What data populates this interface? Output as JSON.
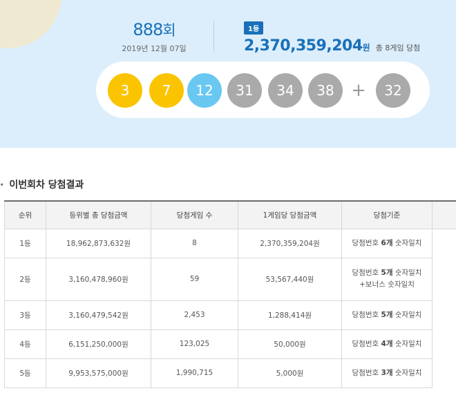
{
  "round": {
    "number": "888",
    "unit": "회",
    "date": "2019년 12월 07일"
  },
  "first_prize": {
    "badge": "1등",
    "amount": "2,370,359,204",
    "unit": "원",
    "games": "총 8게임 당첨"
  },
  "balls": [
    {
      "number": "3",
      "color": "#fbc400"
    },
    {
      "number": "7",
      "color": "#fbc400"
    },
    {
      "number": "12",
      "color": "#69c8f2"
    },
    {
      "number": "31",
      "color": "#aaaaaa"
    },
    {
      "number": "34",
      "color": "#aaaaaa"
    },
    {
      "number": "38",
      "color": "#aaaaaa"
    }
  ],
  "plus": "+",
  "bonus": {
    "number": "32",
    "color": "#aaaaaa"
  },
  "section": {
    "bullet": "·",
    "title": "이번회차 당첨결과"
  },
  "table": {
    "headers": [
      "순위",
      "등위별 총 당첨금액",
      "당첨게임 수",
      "1게임당 당첨금액",
      "당첨기준"
    ],
    "rows": [
      {
        "rank": "1등",
        "total": "18,962,873,632원",
        "games": "8",
        "per_game": "2,370,359,204원",
        "crit_pre": "당첨번호 ",
        "crit_bold": "6개",
        "crit_post": " 숫자일치",
        "crit_line2": ""
      },
      {
        "rank": "2등",
        "total": "3,160,478,960원",
        "games": "59",
        "per_game": "53,567,440원",
        "crit_pre": "당첨번호 ",
        "crit_bold": "5개",
        "crit_post": " 숫자일치",
        "crit_line2": "+보너스 숫자일치"
      },
      {
        "rank": "3등",
        "total": "3,160,479,542원",
        "games": "2,453",
        "per_game": "1,288,414원",
        "crit_pre": "당첨번호 ",
        "crit_bold": "5개",
        "crit_post": " 숫자일치",
        "crit_line2": ""
      },
      {
        "rank": "4등",
        "total": "6,151,250,000원",
        "games": "123,025",
        "per_game": "50,000원",
        "crit_pre": "당첨번호 ",
        "crit_bold": "4개",
        "crit_post": " 숫자일치",
        "crit_line2": ""
      },
      {
        "rank": "5등",
        "total": "9,953,575,000원",
        "games": "1,990,715",
        "per_game": "5,000원",
        "crit_pre": "당첨번호 ",
        "crit_bold": "3개",
        "crit_post": " 숫자일치",
        "crit_line2": ""
      }
    ]
  }
}
